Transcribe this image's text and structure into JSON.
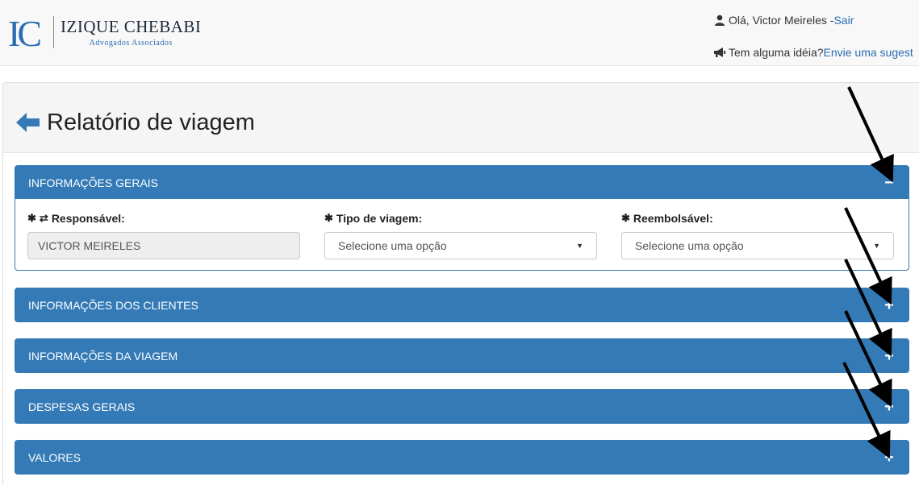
{
  "header": {
    "logo_letters": "IC",
    "logo_name": "IZIQUE CHEBABI",
    "logo_sub": "Advogados Associados",
    "greeting": "Olá, Victor Meireles - ",
    "logout": "Sair",
    "idea_prompt": "Tem alguma idéia? ",
    "idea_link": "Envie uma sugest"
  },
  "page": {
    "title": "Relatório de viagem"
  },
  "sections": {
    "general": {
      "title": "INFORMAÇÕES GERAIS",
      "toggle": "−",
      "fields": {
        "responsavel_label": "Responsável:",
        "responsavel_value": "VICTOR MEIRELES",
        "tipo_label": "Tipo de viagem:",
        "tipo_value": "Selecione uma opção",
        "reembolsavel_label": "Reembolsável:",
        "reembolsavel_value": "Selecione uma opção"
      }
    },
    "clients": {
      "title": "INFORMAÇÕES DOS CLIENTES",
      "toggle": "+"
    },
    "trip": {
      "title": "INFORMAÇÕES DA VIAGEM",
      "toggle": "+"
    },
    "expenses": {
      "title": "DESPESAS GERAIS",
      "toggle": "+"
    },
    "values": {
      "title": "VALORES",
      "toggle": "+"
    }
  },
  "icons": {
    "user": "user-icon",
    "megaphone": "megaphone-icon",
    "back": "arrow-left-icon",
    "required": "asterisk-icon",
    "swap": "swap-icon",
    "caret": "caret-down-icon"
  },
  "colors": {
    "primary": "#337ab7",
    "link": "#2a6db5",
    "header_bg": "#f8f8f8",
    "annotation": "#000000"
  }
}
